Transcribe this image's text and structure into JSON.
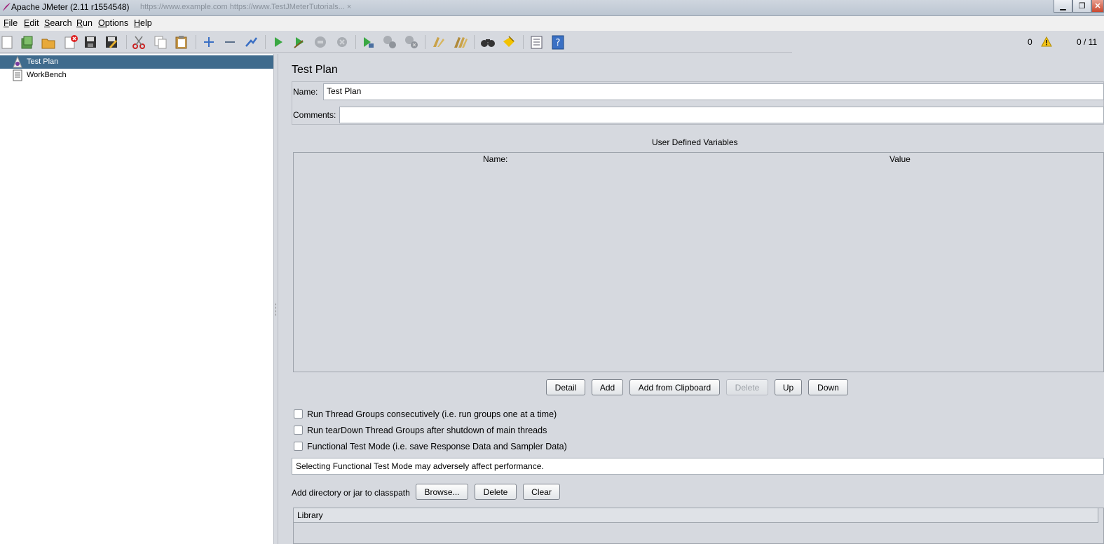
{
  "window": {
    "title": "Apache JMeter (2.11 r1554548)",
    "background_tabs": "https://www.example.com   https://www.TestJMeterTutorials...   ×"
  },
  "menu": [
    "File",
    "Edit",
    "Search",
    "Run",
    "Options",
    "Help"
  ],
  "toolbar": {
    "icons": [
      "new-icon",
      "templates-icon",
      "open-icon",
      "close-icon",
      "save-icon",
      "save-as-icon",
      "cut-icon",
      "copy-icon",
      "paste-icon",
      "expand-icon",
      "collapse-icon",
      "toggle-icon",
      "start-icon",
      "start-no-pauses-icon",
      "stop-icon",
      "shutdown-icon",
      "remote-start-icon",
      "remote-stop-icon",
      "remote-shutdown-icon",
      "clear-icon",
      "clear-all-icon",
      "search-icon",
      "reset-search-icon",
      "function-helper-icon",
      "help-icon"
    ],
    "error_count": "0",
    "thread_count": "0 / 11"
  },
  "tree": [
    {
      "label": "Test Plan",
      "icon": "test-plan-icon",
      "selected": true
    },
    {
      "label": "WorkBench",
      "icon": "workbench-icon",
      "selected": false
    }
  ],
  "panel": {
    "title": "Test Plan",
    "name_label": "Name:",
    "name_value": "Test Plan",
    "comments_label": "Comments:",
    "comments_value": "",
    "udv_title": "User Defined Variables",
    "udv_columns": [
      "Name:",
      "Value"
    ],
    "buttons": {
      "detail": "Detail",
      "add": "Add",
      "add_clipboard": "Add from Clipboard",
      "delete": "Delete",
      "up": "Up",
      "down": "Down"
    },
    "checkboxes": [
      "Run Thread Groups consecutively (i.e. run groups one at a time)",
      "Run tearDown Thread Groups after shutdown of main threads",
      "Functional Test Mode (i.e. save Response Data and Sampler Data)"
    ],
    "functional_note": "Selecting Functional Test Mode may adversely affect performance.",
    "classpath_label": "Add directory or jar to classpath",
    "classpath_buttons": {
      "browse": "Browse...",
      "delete": "Delete",
      "clear": "Clear"
    },
    "library_header": "Library"
  },
  "colors": {
    "selection": "#3f6b8d",
    "panel_bg": "#d6d9df"
  }
}
